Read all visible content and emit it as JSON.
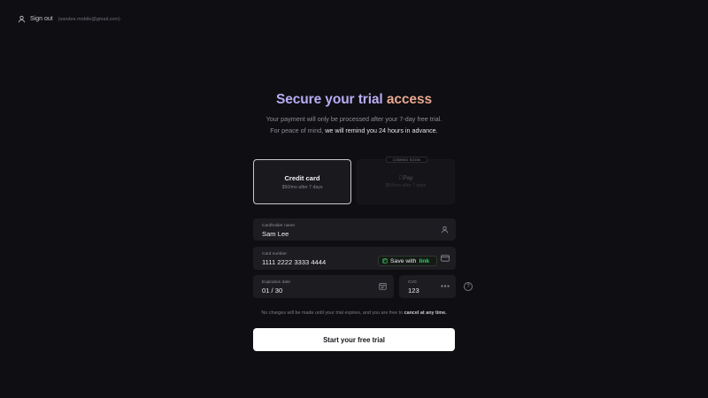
{
  "header": {
    "signout_label": "Sign out",
    "email": "(sandee.mobile@gmail.com)"
  },
  "hero": {
    "title_part1": "Secure your trial",
    "title_part2": "access",
    "subtitle_line1": "Your payment will only be processed after your 7-day free trial.",
    "subtitle_line2_a": "For peace of mind,",
    "subtitle_line2_b": "we will remind you 24 hours in advance."
  },
  "payment_methods": {
    "card": {
      "title": "Credit card",
      "subtitle": "$50/mo after 7 days"
    },
    "apple": {
      "title": "Pay",
      "subtitle": "$50/mo after 7 days"
    },
    "badge": "COMING SOON"
  },
  "form": {
    "name_label": "Cardholder name",
    "name_value": "Sam Lee",
    "card_label": "Card number",
    "card_value": "1111 2222 3333 4444",
    "link_save": "Save with",
    "link_brand": "link",
    "exp_label": "Expiration date",
    "exp_value": "01 / 30",
    "cvc_label": "CVC",
    "cvc_value": "123",
    "help": "?"
  },
  "notice": {
    "text": "No charges will be made until your trial expires, and you are free to",
    "bold": "cancel at any time."
  },
  "cta_label": "Start your free trial",
  "colors": {
    "background": "#0f0e12",
    "title_purple": "#b9acf4",
    "title_peach": "#e7a68f",
    "link_green": "#2fd36a",
    "cta_bg": "#ffffff"
  }
}
